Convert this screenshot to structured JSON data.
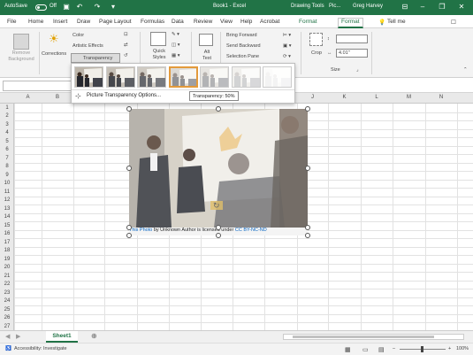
{
  "titlebar": {
    "autosave_label": "AutoSave",
    "autosave_state": "Off",
    "doc_title": "Book1 - Excel",
    "context_tabs_label": "Drawing Tools",
    "pic_label": "Pic...",
    "user": "Greg Harvey",
    "qat_icons": [
      "save-icon",
      "undo-icon",
      "redo-icon",
      "customize-icon"
    ]
  },
  "tabs": [
    "File",
    "Home",
    "Insert",
    "Draw",
    "Page Layout",
    "Formulas",
    "Data",
    "Review",
    "View",
    "Help",
    "Acrobat",
    "Format",
    "Format"
  ],
  "active_tab": "Format",
  "tell_me": "Tell me",
  "ribbon": {
    "remove_background": "Remove Background",
    "corrections": "Corrections",
    "color": "Color",
    "artistic_effects": "Artistic Effects",
    "transparency": "Transparency",
    "quick_styles": "Quick Styles",
    "alt_text": "Alt Text",
    "bring_forward": "Bring Forward",
    "send_backward": "Send Backward",
    "selection_pane": "Selection Pane",
    "crop": "Crop",
    "height_value": "",
    "width_value": "4.01\"",
    "size_group": "Size"
  },
  "gallery": {
    "swatches": [
      "0%",
      "15%",
      "30%",
      "50%",
      "65%",
      "80%",
      "95%"
    ],
    "selected_index": 3,
    "options_label": "Picture Transparency Options..."
  },
  "tooltip": "Transparency: 50%",
  "columns": [
    "A",
    "B",
    "C",
    "D",
    "E",
    "F",
    "G",
    "H",
    "I",
    "J",
    "K",
    "L",
    "M",
    "N"
  ],
  "rows": [
    "1",
    "2",
    "3",
    "4",
    "5",
    "6",
    "7",
    "8",
    "9",
    "10",
    "11",
    "12",
    "13",
    "14",
    "15",
    "16",
    "17",
    "18",
    "19",
    "20",
    "21",
    "22",
    "23",
    "24",
    "25",
    "26",
    "27"
  ],
  "caption": {
    "link1": "This Photo",
    "text1": " by Unknown Author is licensed under ",
    "link2": "CC BY-NC-ND"
  },
  "sheet_tab": "Sheet1",
  "status": {
    "accessibility": "Accessibility: Investigate",
    "zoom": "100%"
  },
  "colors": {
    "excel_green": "#217346",
    "link_blue": "#0563c1"
  }
}
